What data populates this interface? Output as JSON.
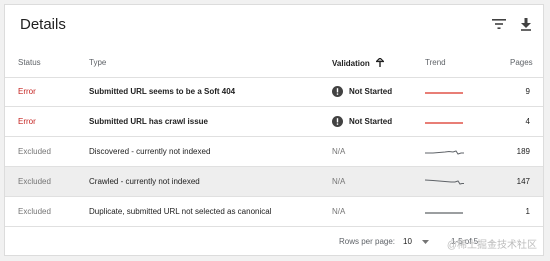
{
  "header": {
    "title": "Details",
    "filter_icon": "filter-icon",
    "download_icon": "download-icon"
  },
  "columns": {
    "status": "Status",
    "type": "Type",
    "validation": "Validation",
    "validation_sort_icon": "arrow-up-icon",
    "trend": "Trend",
    "pages": "Pages"
  },
  "rows": [
    {
      "status": "Error",
      "status_kind": "error",
      "type": "Submitted URL seems to be a Soft 404",
      "type_bold": true,
      "validation": "Not Started",
      "validation_icon": "alert-icon",
      "trend": "flat-red",
      "pages": "9"
    },
    {
      "status": "Error",
      "status_kind": "error",
      "type": "Submitted URL has crawl issue",
      "type_bold": true,
      "validation": "Not Started",
      "validation_icon": "alert-icon",
      "trend": "flat-red",
      "pages": "4"
    },
    {
      "status": "Excluded",
      "status_kind": "excluded",
      "type": "Discovered - currently not indexed",
      "type_bold": false,
      "validation": "N/A",
      "validation_icon": "",
      "trend": "wavy-gray",
      "pages": "189"
    },
    {
      "status": "Excluded",
      "status_kind": "excluded",
      "type": "Crawled - currently not indexed",
      "type_bold": false,
      "validation": "N/A",
      "validation_icon": "",
      "trend": "wavy-gray",
      "pages": "147"
    },
    {
      "status": "Excluded",
      "status_kind": "excluded",
      "type": "Duplicate, submitted URL not selected as canonical",
      "type_bold": false,
      "validation": "N/A",
      "validation_icon": "",
      "trend": "flat-gray",
      "pages": "1"
    }
  ],
  "footer": {
    "rows_per_page_label": "Rows per page:",
    "rows_per_page_value": "10",
    "range": "1-5 of 5"
  },
  "watermark": "@稀土掘金技术社区",
  "colors": {
    "error": "#c5221f",
    "excluded": "#757575",
    "trend_red": "#d93025",
    "trend_gray": "#5f6368"
  }
}
